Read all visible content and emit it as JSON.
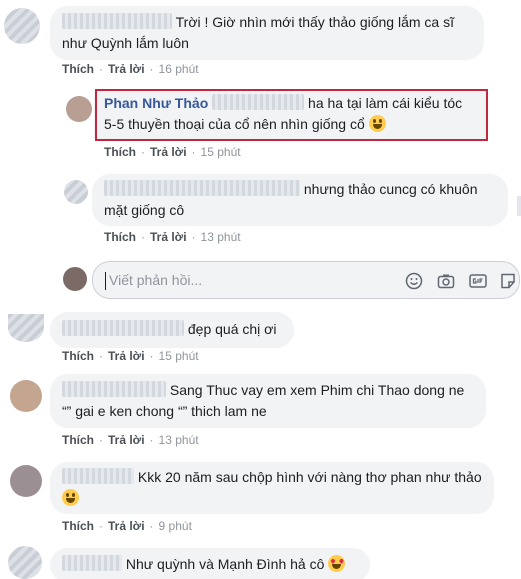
{
  "actions": {
    "like": "Thích",
    "reply": "Trả lời",
    "sep": "·"
  },
  "comments": [
    {
      "text": "Trời ! Giờ nhìn mới thấy thảo giống lắm ca sĩ như Quỳnh lắm luôn",
      "time": "16 phút"
    },
    {
      "name": "Phan Như Thảo",
      "text": "ha ha tại làm cái kiểu tóc 5-5 thuyền thoại của cổ nên nhìn giống cổ",
      "time": "15 phút"
    },
    {
      "text": "nhưng thảo cuncg có khuôn mặt giống cô",
      "time": "13 phút"
    },
    {
      "text": "đẹp quá chị ơi",
      "time": "15 phút"
    },
    {
      "text": "Sang Thuc vay em xem Phim chi Thao dong ne “” gai e ken chong “” thich lam ne",
      "time": "13 phút"
    },
    {
      "text": "Kkk 20 năm sau chộp hình với nàng thơ phan như thảo",
      "time": "9 phút"
    },
    {
      "text": "Như quỳnh và Mạnh Đình hả cô"
    }
  ],
  "reply_box": {
    "placeholder": "Viết phản hồi..."
  },
  "icons": [
    "emoji-icon",
    "camera-icon",
    "gif-icon",
    "sticker-icon"
  ],
  "colors": {
    "highlight": "#c0283f",
    "name": "#385898",
    "bubble": "#f2f3f5"
  }
}
